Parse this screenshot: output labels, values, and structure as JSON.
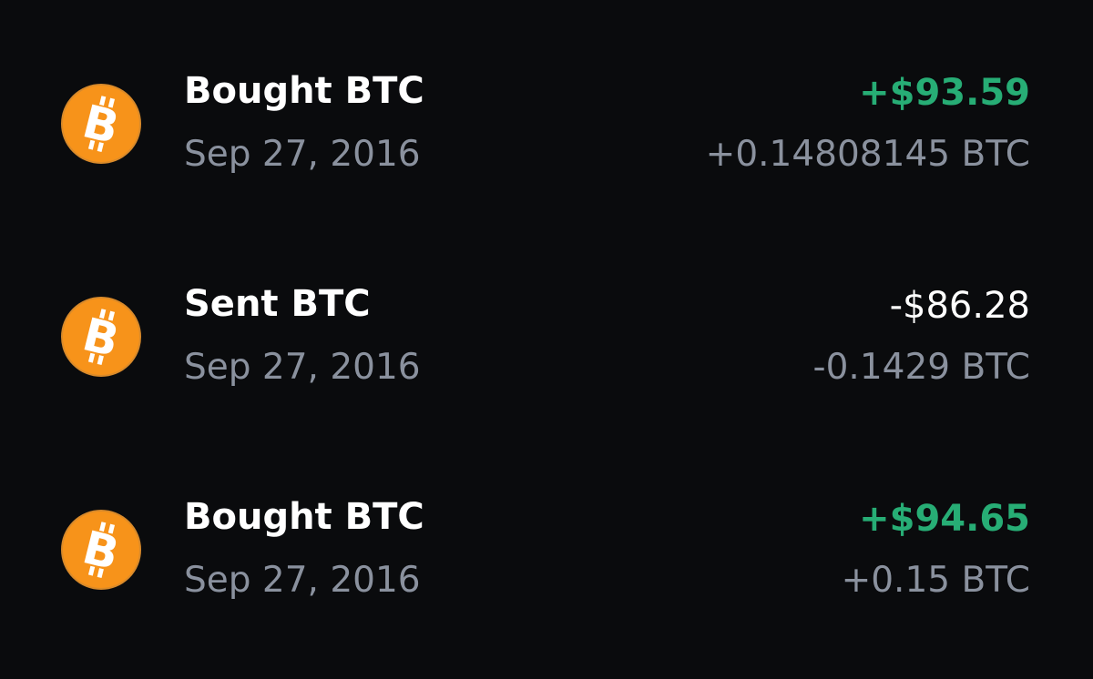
{
  "transactions": [
    {
      "title": "Bought BTC",
      "date": "Sep 27, 2016",
      "fiat_amount": "+$93.59",
      "crypto_amount": "+0.14808145 BTC",
      "direction": "positive",
      "icon": "bitcoin-icon"
    },
    {
      "title": "Sent BTC",
      "date": "Sep 27, 2016",
      "fiat_amount": "-$86.28",
      "crypto_amount": "-0.1429 BTC",
      "direction": "negative",
      "icon": "bitcoin-icon"
    },
    {
      "title": "Bought BTC",
      "date": "Sep 27, 2016",
      "fiat_amount": "+$94.65",
      "crypto_amount": "+0.15 BTC",
      "direction": "positive",
      "icon": "bitcoin-icon"
    }
  ],
  "colors": {
    "background": "#0a0b0d",
    "bitcoin_orange": "#f7931a",
    "positive_green": "#27ad75",
    "secondary_gray": "#8a919e",
    "primary_white": "#ffffff"
  }
}
